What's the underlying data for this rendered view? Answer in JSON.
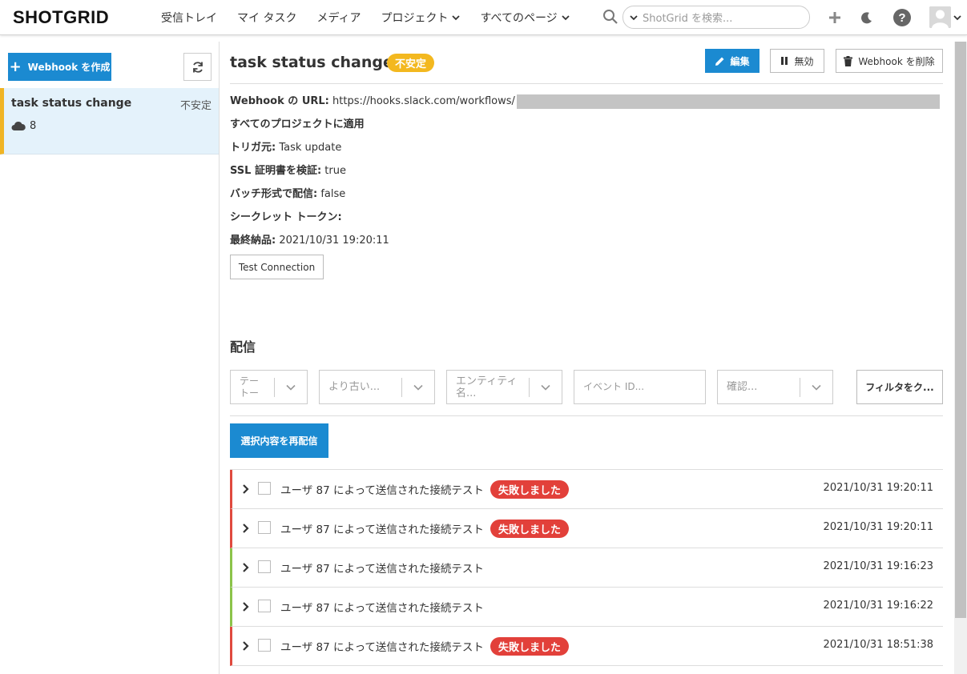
{
  "nav": {
    "logo": "SHOTGRID",
    "items": [
      {
        "label": "受信トレイ",
        "dropdown": false
      },
      {
        "label": "マイ タスク",
        "dropdown": false
      },
      {
        "label": "メディア",
        "dropdown": false
      },
      {
        "label": "プロジェクト",
        "dropdown": true
      },
      {
        "label": "すべてのページ",
        "dropdown": true
      }
    ],
    "search_placeholder": "ShotGrid を検索...",
    "icons": [
      "search-icon",
      "plus-icon",
      "moon-icon",
      "help-icon",
      "user-avatar",
      "chevron-down-icon"
    ]
  },
  "sidebar": {
    "create_label": "Webhook を作成",
    "webhook": {
      "name": "task status change",
      "status": "不安定",
      "count": "8"
    }
  },
  "detail": {
    "title": "task status change",
    "status_badge": "不安定",
    "actions": {
      "edit": "編集",
      "disable": "無効",
      "delete": "Webhook を削除"
    },
    "url_label": "Webhook の URL:",
    "url_value": "https://hooks.slack.com/workflows/",
    "scope": "すべてのプロジェクトに適用",
    "trigger_label": "トリガ元:",
    "trigger_value": "Task update",
    "ssl_label": "SSL 証明書を検証:",
    "ssl_value": "true",
    "batch_label": "バッチ形式で配信:",
    "batch_value": "false",
    "secret_label": "シークレット トークン:",
    "last_label": "最終納品:",
    "last_value": "2021/10/31 19:20:11",
    "test_button": "Test Connection"
  },
  "deliveries": {
    "section_title": "配信",
    "filters": {
      "f1": "テー\nトー",
      "f2": "より古い...",
      "f3": "エンティティ\n名...",
      "event_placeholder": "イベント ID...",
      "f5": "確認...",
      "clear": "フィルタをク..."
    },
    "resend_button": "選択内容を再配信",
    "rows": [
      {
        "message": "ユーザ 87 によって送信された接続テスト",
        "status": "失敗しました",
        "failed": true,
        "time": "2021/10/31 19:20:11"
      },
      {
        "message": "ユーザ 87 によって送信された接続テスト",
        "status": "失敗しました",
        "failed": true,
        "time": "2021/10/31 19:20:11"
      },
      {
        "message": "ユーザ 87 によって送信された接続テスト",
        "status": "",
        "failed": false,
        "time": "2021/10/31 19:16:23"
      },
      {
        "message": "ユーザ 87 によって送信された接続テスト",
        "status": "",
        "failed": false,
        "time": "2021/10/31 19:16:22"
      },
      {
        "message": "ユーザ 87 によって送信された接続テスト",
        "status": "失敗しました",
        "failed": true,
        "time": "2021/10/31 18:51:38"
      }
    ]
  },
  "colors": {
    "accent": "#1b8ad1",
    "unstable": "#f3b81f",
    "failed": "#e2403a",
    "success_bar": "#8bc34a"
  }
}
